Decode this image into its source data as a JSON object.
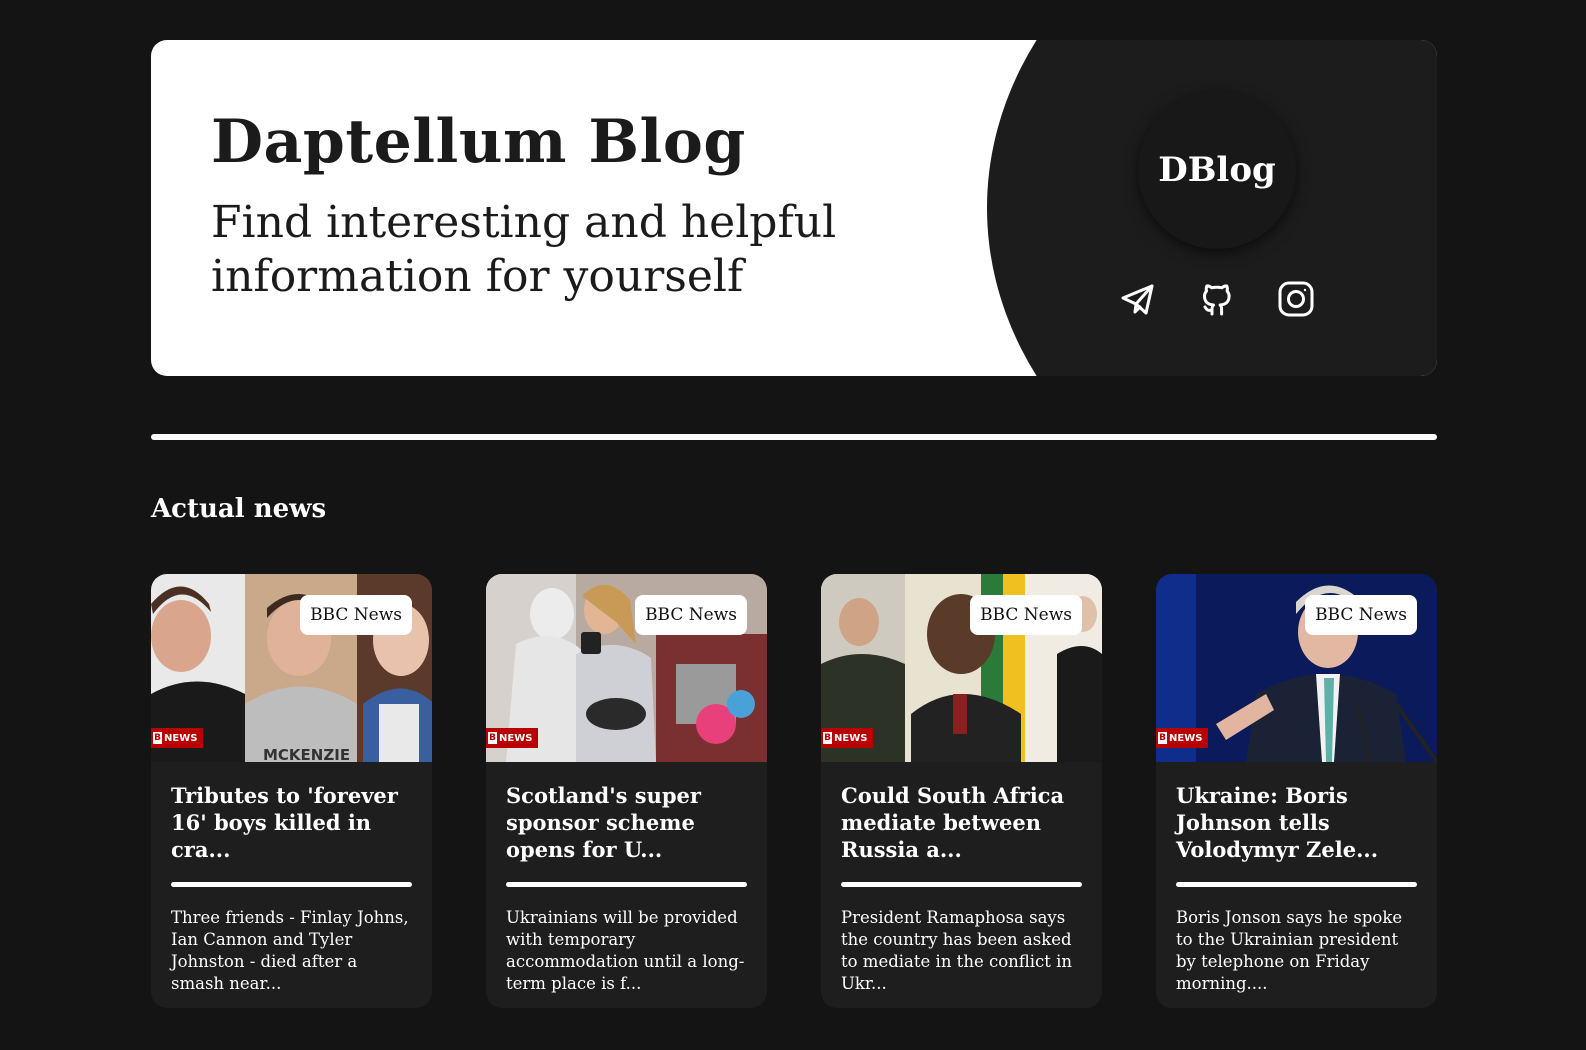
{
  "hero": {
    "title": "Daptellum Blog",
    "subtitle": "Find interesting and helpful information for yourself",
    "logo": "DBlog",
    "socials": [
      {
        "icon": "telegram-icon"
      },
      {
        "icon": "github-icon"
      },
      {
        "icon": "instagram-icon"
      }
    ]
  },
  "section": {
    "title": "Actual news"
  },
  "cards": [
    {
      "source": "BBC News",
      "title": "Tributes to 'forever 16' boys killed in cra...",
      "description": "Three friends - Finlay Johns, Ian Cannon and Tyler Johnston - died after a smash near...",
      "image_text": "MCKENZIE"
    },
    {
      "source": "BBC News",
      "title": "Scotland's super sponsor scheme opens for U...",
      "description": "Ukrainians will be provided with temporary accommodation until a long-term place is f..."
    },
    {
      "source": "BBC News",
      "title": "Could South Africa mediate between Russia a...",
      "description": "President Ramaphosa says the country has been asked to mediate in the conflict in Ukr..."
    },
    {
      "source": "BBC News",
      "title": "Ukraine: Boris Johnson tells Volodymyr Zele...",
      "description": "Boris Jonson says he spoke to the Ukrainian president by telephone on Friday morning...."
    }
  ],
  "bbc_mark": {
    "logo": "B",
    "label": "NEWS"
  },
  "colors": {
    "background": "#141414",
    "panel": "#1c1c1c",
    "card": "#1e1e1e",
    "accent": "#ffffff",
    "bbc_red": "#b80000"
  }
}
